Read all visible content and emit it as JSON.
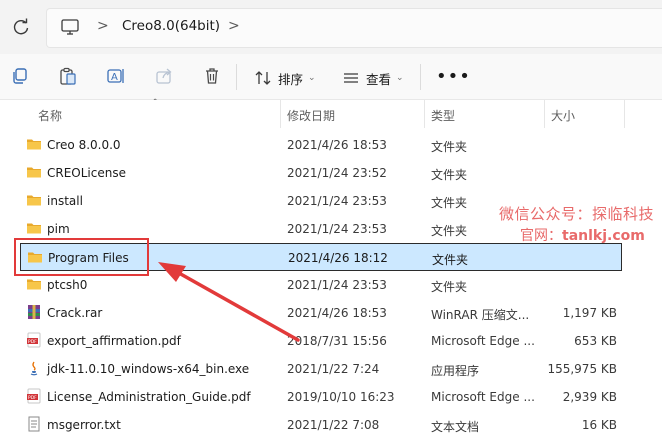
{
  "address": {
    "breadcrumb": "Creo8.0(64bit)",
    "sep1": ">",
    "sep2": ">"
  },
  "toolbar": {
    "sort_label": "排序",
    "view_label": "查看",
    "more_label": "•••"
  },
  "columns": {
    "name": "名称",
    "modified": "修改日期",
    "type": "类型",
    "size": "大小"
  },
  "files": [
    {
      "name": "Creo 8.0.0.0",
      "modified": "2021/4/26 18:53",
      "type": "文件夹",
      "size": "",
      "icon": "folder-icon"
    },
    {
      "name": "CREOLicense",
      "modified": "2021/1/24 23:52",
      "type": "文件夹",
      "size": "",
      "icon": "folder-icon"
    },
    {
      "name": "install",
      "modified": "2021/1/24 23:53",
      "type": "文件夹",
      "size": "",
      "icon": "folder-icon"
    },
    {
      "name": "pim",
      "modified": "2021/1/24 23:53",
      "type": "文件夹",
      "size": "",
      "icon": "folder-icon"
    },
    {
      "name": "Program Files",
      "modified": "2021/4/26 18:12",
      "type": "文件夹",
      "size": "",
      "icon": "folder-icon",
      "selected": true
    },
    {
      "name": "ptcsh0",
      "modified": "2021/1/24 23:53",
      "type": "文件夹",
      "size": "",
      "icon": "folder-icon"
    },
    {
      "name": "Crack.rar",
      "modified": "2021/4/26 18:53",
      "type": "WinRAR 压缩文...",
      "size": "1,197 KB",
      "icon": "rar-icon"
    },
    {
      "name": "export_affirmation.pdf",
      "modified": "2018/7/31 15:56",
      "type": "Microsoft Edge ...",
      "size": "653 KB",
      "icon": "pdf-icon"
    },
    {
      "name": "jdk-11.0.10_windows-x64_bin.exe",
      "modified": "2021/1/22 7:24",
      "type": "应用程序",
      "size": "155,975 KB",
      "icon": "java-icon"
    },
    {
      "name": "License_Administration_Guide.pdf",
      "modified": "2019/10/10 16:23",
      "type": "Microsoft Edge ...",
      "size": "2,939 KB",
      "icon": "pdf-icon"
    },
    {
      "name": "msgerror.txt",
      "modified": "2021/1/22 7:08",
      "type": "文本文档",
      "size": "16 KB",
      "icon": "txt-icon"
    }
  ],
  "watermark": {
    "line1": "微信公众号：探临科技",
    "line2_prefix": "官网：",
    "line2_site": "tanlkj.com"
  },
  "colors": {
    "selection": "#cce8ff",
    "annotation_red": "#e23a3a",
    "folder": "#f5c242"
  }
}
